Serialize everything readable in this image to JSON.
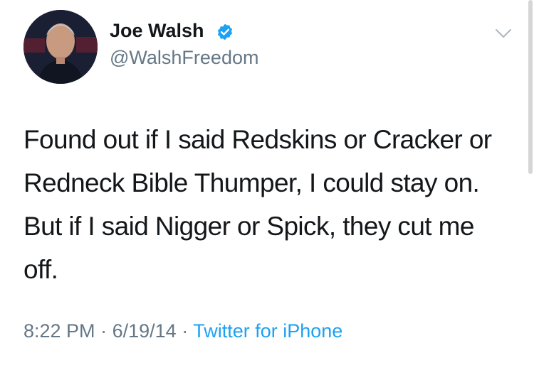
{
  "author": {
    "display_name": "Joe Walsh",
    "handle": "@WalshFreedom",
    "verified": true,
    "avatar_icon": "profile-photo"
  },
  "tweet": {
    "text": "Found out if I said Redskins or Cracker or Redneck Bible Thumper, I could stay on. But if I said Nigger or Spick, they cut me off."
  },
  "meta": {
    "time": "8:22 PM",
    "separator": "·",
    "date": "6/19/14",
    "source": "Twitter for iPhone"
  },
  "colors": {
    "verified_badge": "#1da1f2",
    "link": "#1da1f2",
    "secondary_text": "#657786"
  },
  "icons": {
    "verified": "verified-badge-icon",
    "menu": "chevron-down-icon"
  }
}
